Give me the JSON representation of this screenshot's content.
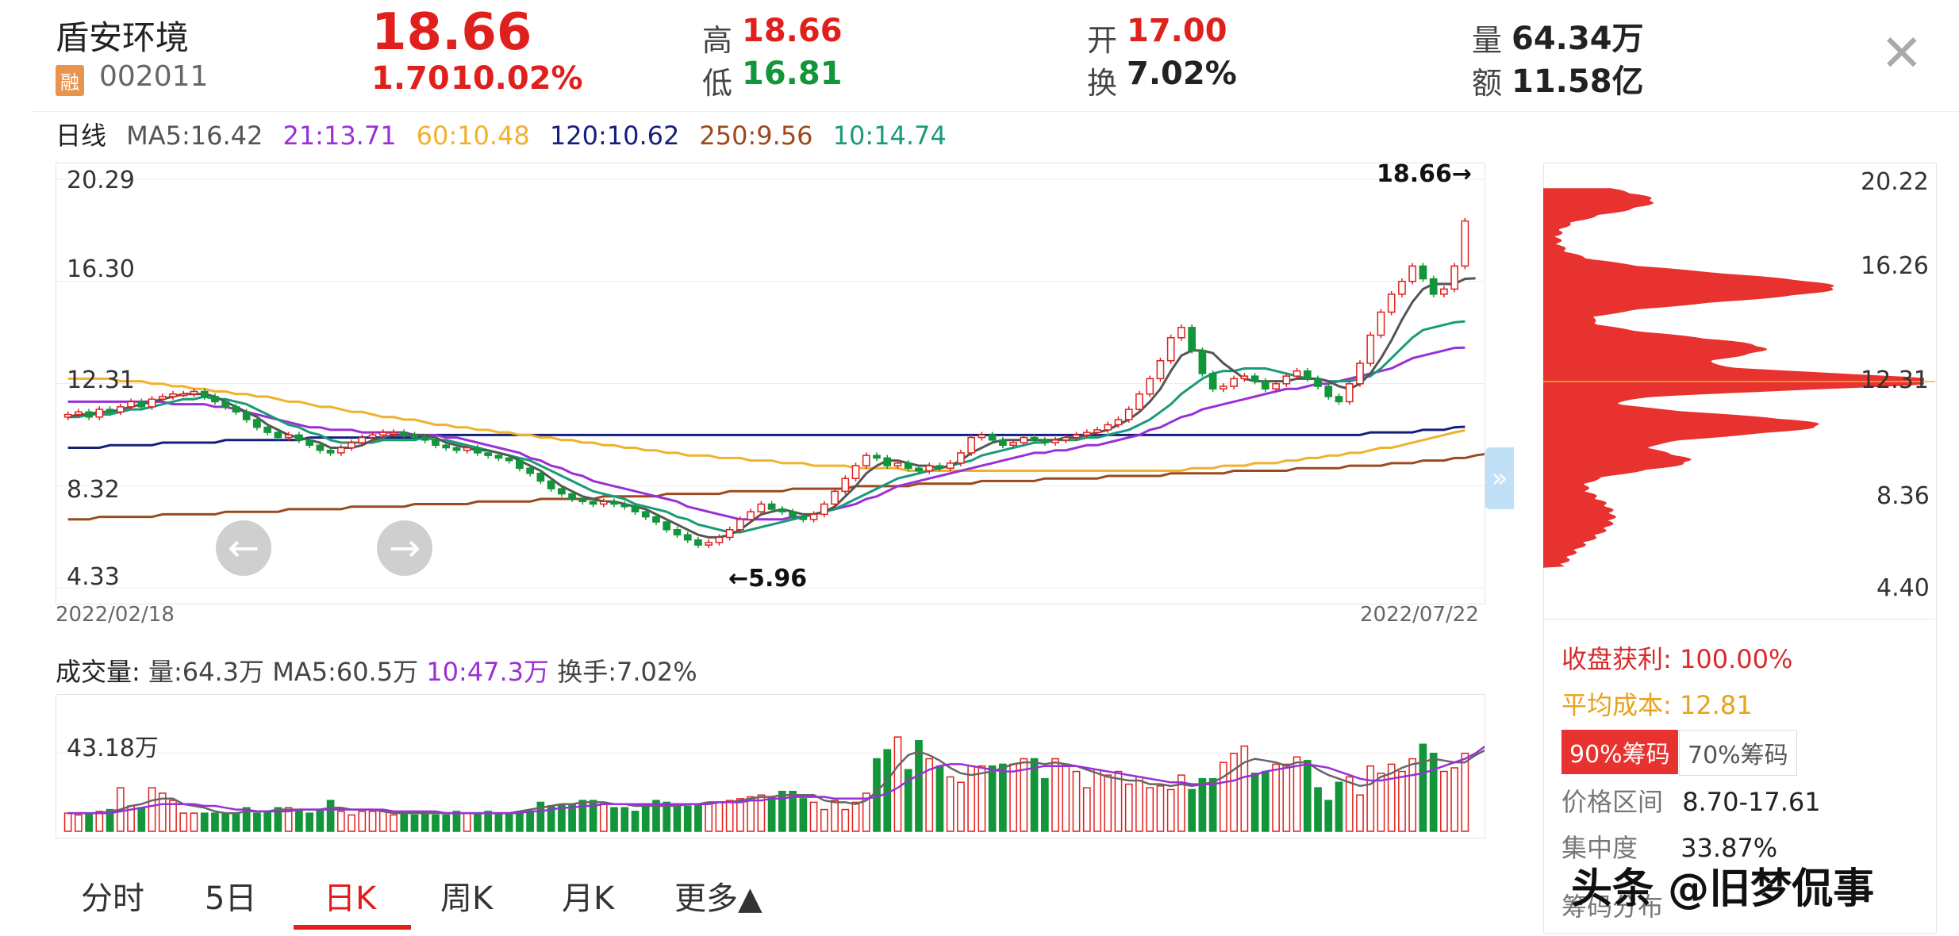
{
  "header": {
    "stock_name": "盾安环境",
    "badge": "融",
    "code": "002011",
    "price": "18.66",
    "change": "1.70",
    "change_pct": "10.02%",
    "high_label": "高",
    "high": "18.66",
    "low_label": "低",
    "low": "16.81",
    "open_label": "开",
    "open": "17.00",
    "turnover_label": "换",
    "turnover": "7.02%",
    "volume_label": "量",
    "volume": "64.34万",
    "amount_label": "额",
    "amount": "11.58亿",
    "close_glyph": "✕"
  },
  "legend": {
    "title": "日线",
    "ma5": "MA5:16.42",
    "ma21": "21:13.71",
    "ma60": "60:10.48",
    "ma120": "120:10.62",
    "ma250": "250:9.56",
    "ma10": "10:14.74"
  },
  "colors": {
    "up": "#e0201c",
    "down": "#13953a",
    "ma5": "#555555",
    "ma21": "#9b2fd6",
    "ma60": "#f0b12c",
    "ma120": "#16207a",
    "ma250": "#9a4a1e",
    "ma10": "#1a9a78",
    "chip": "#e8322f"
  },
  "chart": {
    "y_labels": [
      "20.29",
      "16.30",
      "12.31",
      "8.32",
      "4.33"
    ],
    "y_values": [
      20.29,
      16.3,
      12.31,
      8.32,
      4.33
    ],
    "date_start": "2022/02/18",
    "date_end": "2022/07/22",
    "max_annotation": "18.66→",
    "min_annotation": "←5.96"
  },
  "chart_data": {
    "type": "candlestick",
    "ylim": [
      4.33,
      20.29
    ],
    "x_start": "2022/02/18",
    "x_end": "2022/07/22",
    "close": [
      11.1,
      11.2,
      11.0,
      11.3,
      11.2,
      11.4,
      11.6,
      11.4,
      11.7,
      11.8,
      11.9,
      11.9,
      12.0,
      11.8,
      11.6,
      11.4,
      11.2,
      10.9,
      10.6,
      10.4,
      10.2,
      10.3,
      10.1,
      9.9,
      9.7,
      9.6,
      9.8,
      10.0,
      10.2,
      10.3,
      10.4,
      10.4,
      10.3,
      10.2,
      10.1,
      9.9,
      9.8,
      9.7,
      9.8,
      9.6,
      9.5,
      9.4,
      9.3,
      9.0,
      8.8,
      8.5,
      8.2,
      8.0,
      7.8,
      7.7,
      7.6,
      7.7,
      7.6,
      7.5,
      7.3,
      7.1,
      6.9,
      6.6,
      6.4,
      6.2,
      6.0,
      6.1,
      6.3,
      6.6,
      7.0,
      7.3,
      7.6,
      7.4,
      7.3,
      7.1,
      7.0,
      7.2,
      7.6,
      8.1,
      8.6,
      9.1,
      9.5,
      9.4,
      9.1,
      9.2,
      9.0,
      8.9,
      9.1,
      9.0,
      9.2,
      9.6,
      10.2,
      10.3,
      10.1,
      9.9,
      10.0,
      10.2,
      10.1,
      10.0,
      10.1,
      10.2,
      10.3,
      10.4,
      10.5,
      10.7,
      10.9,
      11.3,
      11.9,
      12.5,
      13.2,
      14.1,
      14.5,
      13.6,
      12.7,
      12.1,
      12.2,
      12.5,
      12.6,
      12.4,
      12.1,
      12.3,
      12.6,
      12.8,
      12.5,
      12.2,
      11.8,
      11.6,
      12.3,
      13.1,
      14.2,
      15.1,
      15.8,
      16.3,
      16.9,
      16.4,
      15.8,
      16.0,
      16.9,
      18.66
    ],
    "ma5": [
      11.0,
      11.1,
      11.1,
      11.2,
      11.2,
      11.3,
      11.4,
      11.5,
      11.6,
      11.7,
      11.8,
      11.9,
      11.9,
      11.9,
      11.8,
      11.6,
      11.4,
      11.2,
      11.0,
      10.7,
      10.5,
      10.3,
      10.2,
      10.1,
      10.0,
      9.8,
      9.8,
      9.8,
      9.9,
      10.1,
      10.2,
      10.3,
      10.3,
      10.3,
      10.3,
      10.2,
      10.0,
      9.9,
      9.8,
      9.7,
      9.7,
      9.6,
      9.5,
      9.3,
      9.1,
      8.9,
      8.6,
      8.3,
      8.1,
      7.9,
      7.8,
      7.7,
      7.7,
      7.6,
      7.5,
      7.4,
      7.2,
      7.0,
      6.8,
      6.6,
      6.4,
      6.3,
      6.3,
      6.4,
      6.6,
      6.9,
      7.2,
      7.3,
      7.4,
      7.3,
      7.2,
      7.2,
      7.3,
      7.5,
      7.9,
      8.3,
      8.8,
      9.1,
      9.3,
      9.3,
      9.2,
      9.1,
      9.1,
      9.0,
      9.1,
      9.3,
      9.6,
      9.8,
      10.0,
      10.1,
      10.1,
      10.1,
      10.1,
      10.1,
      10.1,
      10.2,
      10.2,
      10.3,
      10.4,
      10.5,
      10.7,
      10.9,
      11.2,
      11.6,
      12.1,
      12.8,
      13.4,
      13.6,
      13.6,
      13.5,
      13.1,
      12.8,
      12.5,
      12.4,
      12.4,
      12.4,
      12.4,
      12.5,
      12.5,
      12.5,
      12.4,
      12.2,
      12.1,
      12.3,
      12.7,
      13.3,
      14.0,
      14.8,
      15.5,
      16.0,
      16.2,
      16.2,
      16.2,
      16.4,
      16.42
    ],
    "ma10": [
      11.0,
      11.0,
      11.1,
      11.1,
      11.1,
      11.2,
      11.3,
      11.3,
      11.4,
      11.5,
      11.6,
      11.7,
      11.7,
      11.8,
      11.7,
      11.7,
      11.6,
      11.5,
      11.3,
      11.1,
      10.9,
      10.7,
      10.6,
      10.4,
      10.3,
      10.1,
      10.0,
      10.0,
      10.0,
      10.0,
      10.1,
      10.1,
      10.1,
      10.1,
      10.2,
      10.1,
      10.1,
      10.0,
      9.9,
      9.8,
      9.7,
      9.6,
      9.5,
      9.4,
      9.3,
      9.1,
      8.9,
      8.7,
      8.5,
      8.3,
      8.1,
      8.0,
      7.9,
      7.8,
      7.6,
      7.5,
      7.4,
      7.3,
      7.1,
      7.0,
      6.8,
      6.7,
      6.6,
      6.5,
      6.5,
      6.6,
      6.7,
      6.8,
      6.9,
      7.0,
      7.1,
      7.2,
      7.3,
      7.4,
      7.6,
      7.8,
      8.0,
      8.2,
      8.4,
      8.6,
      8.7,
      8.8,
      8.9,
      9.0,
      9.1,
      9.2,
      9.3,
      9.5,
      9.6,
      9.7,
      9.8,
      9.9,
      10.0,
      10.0,
      10.1,
      10.1,
      10.1,
      10.2,
      10.2,
      10.3,
      10.4,
      10.5,
      10.7,
      10.9,
      11.2,
      11.5,
      11.9,
      12.2,
      12.5,
      12.7,
      12.8,
      12.8,
      12.9,
      12.9,
      12.9,
      12.8,
      12.7,
      12.6,
      12.5,
      12.5,
      12.4,
      12.4,
      12.4,
      12.5,
      12.6,
      12.9,
      13.3,
      13.7,
      14.1,
      14.4,
      14.5,
      14.6,
      14.7,
      14.74
    ],
    "ma21": [
      11.6,
      11.6,
      11.6,
      11.6,
      11.6,
      11.6,
      11.6,
      11.6,
      11.6,
      11.6,
      11.5,
      11.5,
      11.5,
      11.5,
      11.4,
      11.4,
      11.3,
      11.2,
      11.1,
      11.0,
      10.9,
      10.8,
      10.7,
      10.6,
      10.6,
      10.5,
      10.5,
      10.5,
      10.4,
      10.4,
      10.4,
      10.4,
      10.4,
      10.3,
      10.3,
      10.3,
      10.2,
      10.2,
      10.1,
      10.0,
      9.9,
      9.8,
      9.7,
      9.6,
      9.4,
      9.3,
      9.1,
      9.0,
      8.8,
      8.7,
      8.5,
      8.4,
      8.3,
      8.2,
      8.1,
      8.0,
      7.9,
      7.8,
      7.7,
      7.5,
      7.4,
      7.3,
      7.2,
      7.1,
      7.0,
      7.0,
      7.0,
      7.0,
      7.0,
      7.1,
      7.1,
      7.2,
      7.3,
      7.4,
      7.5,
      7.6,
      7.8,
      7.9,
      8.1,
      8.3,
      8.4,
      8.5,
      8.6,
      8.7,
      8.8,
      8.9,
      9.0,
      9.1,
      9.2,
      9.3,
      9.4,
      9.5,
      9.6,
      9.6,
      9.7,
      9.7,
      9.8,
      9.9,
      9.9,
      10.0,
      10.1,
      10.2,
      10.3,
      10.5,
      10.6,
      10.8,
      11.0,
      11.1,
      11.3,
      11.4,
      11.5,
      11.6,
      11.7,
      11.8,
      11.9,
      12.0,
      12.1,
      12.1,
      12.2,
      12.3,
      12.3,
      12.4,
      12.5,
      12.6,
      12.7,
      12.8,
      12.9,
      13.1,
      13.3,
      13.4,
      13.5,
      13.6,
      13.7,
      13.71
    ],
    "ma60": [
      12.5,
      12.5,
      12.5,
      12.5,
      12.5,
      12.4,
      12.4,
      12.4,
      12.3,
      12.3,
      12.2,
      12.2,
      12.1,
      12.1,
      12.0,
      12.0,
      11.9,
      11.9,
      11.8,
      11.8,
      11.7,
      11.6,
      11.6,
      11.5,
      11.4,
      11.4,
      11.3,
      11.2,
      11.2,
      11.1,
      11.0,
      11.0,
      10.9,
      10.9,
      10.8,
      10.7,
      10.7,
      10.6,
      10.6,
      10.5,
      10.5,
      10.4,
      10.4,
      10.3,
      10.3,
      10.2,
      10.2,
      10.1,
      10.1,
      10.0,
      10.0,
      9.9,
      9.9,
      9.8,
      9.8,
      9.7,
      9.7,
      9.6,
      9.6,
      9.5,
      9.5,
      9.5,
      9.4,
      9.4,
      9.4,
      9.3,
      9.3,
      9.3,
      9.2,
      9.2,
      9.2,
      9.1,
      9.1,
      9.1,
      9.1,
      9.0,
      9.0,
      9.0,
      9.0,
      9.0,
      8.9,
      8.9,
      8.9,
      8.9,
      8.9,
      8.9,
      8.9,
      8.9,
      8.9,
      8.9,
      8.9,
      8.9,
      8.9,
      8.9,
      8.9,
      8.9,
      8.9,
      8.9,
      8.9,
      8.9,
      8.9,
      8.9,
      8.9,
      8.9,
      8.9,
      8.9,
      8.9,
      9.0,
      9.0,
      9.0,
      9.1,
      9.1,
      9.1,
      9.2,
      9.2,
      9.2,
      9.3,
      9.3,
      9.4,
      9.4,
      9.5,
      9.5,
      9.6,
      9.6,
      9.7,
      9.8,
      9.8,
      9.9,
      10.0,
      10.1,
      10.2,
      10.3,
      10.4,
      10.48
    ],
    "ma120": [
      9.8,
      9.8,
      9.8,
      9.8,
      9.9,
      9.9,
      9.9,
      9.9,
      9.9,
      10.0,
      10.0,
      10.0,
      10.0,
      10.0,
      10.0,
      10.1,
      10.1,
      10.1,
      10.1,
      10.1,
      10.1,
      10.1,
      10.1,
      10.2,
      10.2,
      10.2,
      10.2,
      10.2,
      10.2,
      10.2,
      10.2,
      10.2,
      10.2,
      10.2,
      10.2,
      10.3,
      10.3,
      10.3,
      10.3,
      10.3,
      10.3,
      10.3,
      10.3,
      10.3,
      10.3,
      10.3,
      10.3,
      10.3,
      10.3,
      10.3,
      10.3,
      10.3,
      10.3,
      10.3,
      10.3,
      10.3,
      10.3,
      10.3,
      10.3,
      10.3,
      10.3,
      10.3,
      10.3,
      10.3,
      10.3,
      10.3,
      10.3,
      10.3,
      10.3,
      10.3,
      10.3,
      10.3,
      10.3,
      10.3,
      10.3,
      10.3,
      10.3,
      10.3,
      10.3,
      10.3,
      10.3,
      10.3,
      10.3,
      10.3,
      10.3,
      10.3,
      10.3,
      10.3,
      10.3,
      10.3,
      10.3,
      10.3,
      10.3,
      10.3,
      10.3,
      10.3,
      10.3,
      10.3,
      10.3,
      10.3,
      10.3,
      10.3,
      10.3,
      10.3,
      10.3,
      10.3,
      10.3,
      10.3,
      10.3,
      10.3,
      10.3,
      10.3,
      10.3,
      10.3,
      10.3,
      10.3,
      10.3,
      10.3,
      10.3,
      10.3,
      10.3,
      10.3,
      10.3,
      10.3,
      10.4,
      10.4,
      10.4,
      10.4,
      10.4,
      10.5,
      10.5,
      10.5,
      10.6,
      10.62
    ],
    "ma250": [
      7.0,
      7.0,
      7.0,
      7.1,
      7.1,
      7.1,
      7.1,
      7.1,
      7.1,
      7.2,
      7.2,
      7.2,
      7.2,
      7.2,
      7.2,
      7.3,
      7.3,
      7.3,
      7.3,
      7.3,
      7.3,
      7.4,
      7.4,
      7.4,
      7.4,
      7.4,
      7.4,
      7.5,
      7.5,
      7.5,
      7.5,
      7.5,
      7.5,
      7.6,
      7.6,
      7.6,
      7.6,
      7.6,
      7.6,
      7.7,
      7.7,
      7.7,
      7.7,
      7.7,
      7.7,
      7.8,
      7.8,
      7.8,
      7.8,
      7.8,
      7.8,
      7.9,
      7.9,
      7.9,
      7.9,
      7.9,
      7.9,
      8.0,
      8.0,
      8.0,
      8.0,
      8.0,
      8.0,
      8.1,
      8.1,
      8.1,
      8.1,
      8.1,
      8.1,
      8.2,
      8.2,
      8.2,
      8.2,
      8.2,
      8.2,
      8.3,
      8.3,
      8.3,
      8.3,
      8.3,
      8.3,
      8.4,
      8.4,
      8.4,
      8.4,
      8.4,
      8.4,
      8.5,
      8.5,
      8.5,
      8.5,
      8.5,
      8.5,
      8.6,
      8.6,
      8.6,
      8.6,
      8.6,
      8.6,
      8.7,
      8.7,
      8.7,
      8.7,
      8.7,
      8.7,
      8.8,
      8.8,
      8.8,
      8.8,
      8.8,
      8.8,
      8.9,
      8.9,
      8.9,
      8.9,
      8.9,
      8.9,
      9.0,
      9.0,
      9.0,
      9.0,
      9.0,
      9.1,
      9.1,
      9.1,
      9.1,
      9.2,
      9.2,
      9.2,
      9.3,
      9.3,
      9.3,
      9.4,
      9.4,
      9.5,
      9.56
    ],
    "volume_wan": [
      10,
      9,
      10,
      11,
      12,
      24,
      14,
      13,
      24,
      21,
      17,
      10,
      10,
      10,
      10,
      10,
      10,
      13,
      10,
      11,
      13,
      13,
      12,
      10,
      12,
      17,
      11,
      9,
      11,
      11,
      11,
      9,
      10,
      9,
      10,
      9,
      9,
      11,
      10,
      10,
      11,
      10,
      10,
      11,
      11,
      16,
      14,
      15,
      15,
      17,
      17,
      16,
      13,
      13,
      11,
      14,
      17,
      16,
      15,
      14,
      15,
      16,
      16,
      17,
      18,
      19,
      20,
      19,
      22,
      22,
      18,
      16,
      12,
      17,
      12,
      16,
      21,
      40,
      45,
      52,
      34,
      50,
      40,
      36,
      30,
      27,
      36,
      36,
      36,
      37,
      37,
      40,
      40,
      29,
      40,
      37,
      33,
      24,
      34,
      31,
      33,
      26,
      30,
      24,
      25,
      23,
      31,
      23,
      29,
      29,
      38,
      43,
      47,
      32,
      33,
      37,
      37,
      41,
      39,
      24,
      17,
      27,
      30,
      20,
      36,
      32,
      37,
      33,
      40,
      48,
      43,
      33,
      35,
      43,
      64.3
    ],
    "volume_ma5": [
      10,
      10,
      10,
      10,
      11,
      12,
      14,
      15,
      17,
      18,
      18,
      15,
      14,
      13,
      11,
      10,
      10,
      11,
      11,
      11,
      12,
      12,
      12,
      12,
      12,
      13,
      13,
      12,
      12,
      12,
      11,
      10,
      10,
      10,
      10,
      10,
      10,
      10,
      10,
      10,
      10,
      10,
      10,
      11,
      12,
      13,
      14,
      15,
      15,
      16,
      16,
      16,
      15,
      15,
      14,
      14,
      14,
      14,
      14,
      15,
      15,
      16,
      16,
      16,
      17,
      18,
      19,
      19,
      20,
      20,
      20,
      20,
      17,
      16,
      16,
      15,
      17,
      22,
      28,
      36,
      42,
      44,
      42,
      39,
      35,
      32,
      31,
      32,
      33,
      35,
      37,
      38,
      38,
      37,
      38,
      37,
      36,
      34,
      32,
      30,
      29,
      28,
      28,
      26,
      26,
      25,
      26,
      25,
      26,
      27,
      30,
      34,
      38,
      40,
      39,
      38,
      36,
      38,
      38,
      34,
      31,
      29,
      27,
      25,
      26,
      30,
      32,
      35,
      37,
      38,
      40,
      39,
      38,
      38,
      42,
      45,
      60.5
    ],
    "volume_ma10": [
      10,
      10,
      10,
      10,
      10,
      11,
      12,
      13,
      14,
      15,
      15,
      15,
      15,
      14,
      14,
      13,
      12,
      12,
      11,
      11,
      11,
      11,
      12,
      12,
      12,
      12,
      12,
      12,
      12,
      12,
      12,
      11,
      11,
      11,
      11,
      11,
      10,
      10,
      10,
      10,
      10,
      10,
      10,
      10,
      11,
      11,
      12,
      13,
      13,
      14,
      14,
      15,
      15,
      15,
      15,
      15,
      15,
      15,
      15,
      15,
      15,
      15,
      16,
      16,
      16,
      17,
      17,
      18,
      18,
      19,
      19,
      19,
      19,
      18,
      18,
      18,
      18,
      19,
      21,
      24,
      28,
      31,
      34,
      36,
      37,
      37,
      36,
      35,
      34,
      33,
      33,
      34,
      35,
      36,
      36,
      36,
      36,
      35,
      34,
      33,
      32,
      31,
      30,
      29,
      28,
      27,
      27,
      26,
      26,
      26,
      27,
      28,
      30,
      31,
      33,
      34,
      35,
      36,
      37,
      36,
      35,
      33,
      31,
      29,
      28,
      28,
      29,
      30,
      31,
      32,
      34,
      36,
      38,
      40,
      43,
      47.3
    ]
  },
  "volume": {
    "title": "成交量:",
    "vol": "量:64.3万",
    "ma5": "MA5:60.5万",
    "ma10": "10:47.3万",
    "turnover": "换手:7.02%",
    "y_label": "43.18万"
  },
  "chips": {
    "y_labels": [
      "20.22",
      "16.26",
      "12.31",
      "8.36",
      "4.40"
    ],
    "profit_label": "收盘获利:",
    "profit": "100.00%",
    "avg_cost_label": "平均成本:",
    "avg_cost": "12.81",
    "btn_90": "90%筹码",
    "btn_70": "70%筹码",
    "range_label": "价格区间",
    "range": "8.70-17.61",
    "concentration_label": "集中度",
    "concentration": "33.87%",
    "distribution_label": "筹码分布",
    "collapse_glyph": "»"
  },
  "tabs": [
    {
      "label": "分时"
    },
    {
      "label": "5日"
    },
    {
      "label": "日K"
    },
    {
      "label": "周K"
    },
    {
      "label": "月K"
    },
    {
      "label": "更多▲"
    }
  ],
  "watermark": "头条 @旧梦侃事"
}
